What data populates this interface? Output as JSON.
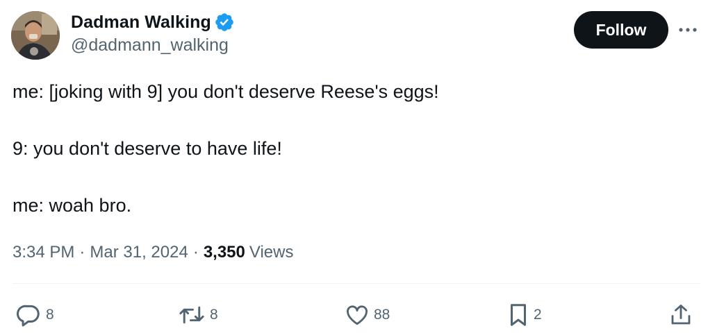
{
  "author": {
    "display_name": "Dadman Walking",
    "handle": "@dadmann_walking",
    "verified": true,
    "verified_color": "#1d9bf0"
  },
  "follow_button": {
    "label": "Follow"
  },
  "more_button": {
    "icon": "more-horizontal-icon"
  },
  "tweet": {
    "lines": [
      "me: [joking with 9] you don't deserve Reese's eggs!",
      "9: you don't deserve to have life!",
      "me: woah bro."
    ],
    "time": "3:34 PM",
    "separator": "·",
    "date": "Mar 31, 2024",
    "views_count": "3,350",
    "views_label": "Views"
  },
  "actions": {
    "reply": {
      "icon": "reply-icon",
      "count": "8"
    },
    "retweet": {
      "icon": "retweet-icon",
      "count": "8"
    },
    "like": {
      "icon": "heart-icon",
      "count": "88"
    },
    "bookmark": {
      "icon": "bookmark-icon",
      "count": "2"
    },
    "share": {
      "icon": "share-icon"
    }
  },
  "colors": {
    "text_primary": "#0f1419",
    "text_secondary": "#536471",
    "divider": "#eff3f4"
  }
}
